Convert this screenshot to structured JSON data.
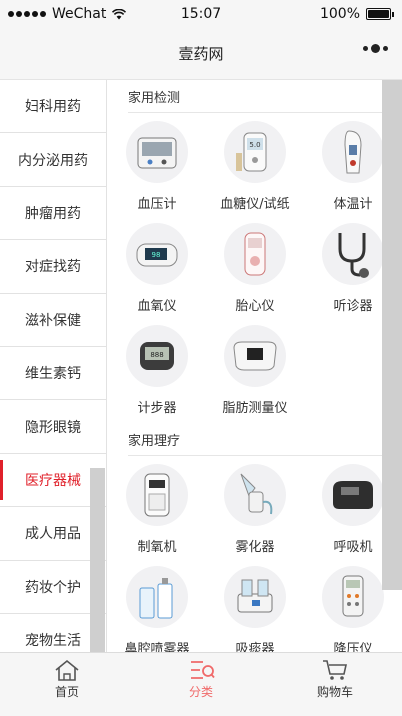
{
  "status_bar": {
    "carrier": "WeChat",
    "time": "15:07",
    "battery": "100%"
  },
  "nav": {
    "title": "壹药网"
  },
  "sidebar": {
    "items": [
      {
        "label": "妇科用药"
      },
      {
        "label": "内分泌用药"
      },
      {
        "label": "肿瘤用药"
      },
      {
        "label": "对症找药"
      },
      {
        "label": "滋补保健"
      },
      {
        "label": "维生素钙"
      },
      {
        "label": "隐形眼镜"
      },
      {
        "label": "医疗器械",
        "active": true
      },
      {
        "label": "成人用品"
      },
      {
        "label": "药妆个护"
      },
      {
        "label": "宠物生活"
      }
    ]
  },
  "sections": [
    {
      "title": "家用检测",
      "items": [
        {
          "label": "血压计",
          "icon": "blood-pressure-monitor-icon"
        },
        {
          "label": "血糖仪/试纸",
          "icon": "glucose-meter-icon"
        },
        {
          "label": "体温计",
          "icon": "ear-thermometer-icon"
        },
        {
          "label": "血氧仪",
          "icon": "pulse-oximeter-icon"
        },
        {
          "label": "胎心仪",
          "icon": "fetal-doppler-icon"
        },
        {
          "label": "听诊器",
          "icon": "stethoscope-icon"
        },
        {
          "label": "计步器",
          "icon": "pedometer-icon"
        },
        {
          "label": "脂肪测量仪",
          "icon": "body-fat-analyzer-icon"
        }
      ]
    },
    {
      "title": "家用理疗",
      "items": [
        {
          "label": "制氧机",
          "icon": "oxygen-concentrator-icon"
        },
        {
          "label": "雾化器",
          "icon": "nebulizer-icon"
        },
        {
          "label": "呼吸机",
          "icon": "ventilator-icon"
        },
        {
          "label": "鼻腔喷雾器",
          "icon": "nasal-spray-icon"
        },
        {
          "label": "吸痰器",
          "icon": "suction-machine-icon"
        },
        {
          "label": "降压仪",
          "icon": "blood-pressure-reducer-icon"
        }
      ]
    }
  ],
  "tabs": [
    {
      "label": "首页",
      "icon": "home-icon"
    },
    {
      "label": "分类",
      "icon": "category-icon",
      "active": true
    },
    {
      "label": "购物车",
      "icon": "cart-icon"
    }
  ],
  "colors": {
    "accent": "#e0202a",
    "tab_active": "#f06a6a",
    "background": "#f6f6f6"
  }
}
